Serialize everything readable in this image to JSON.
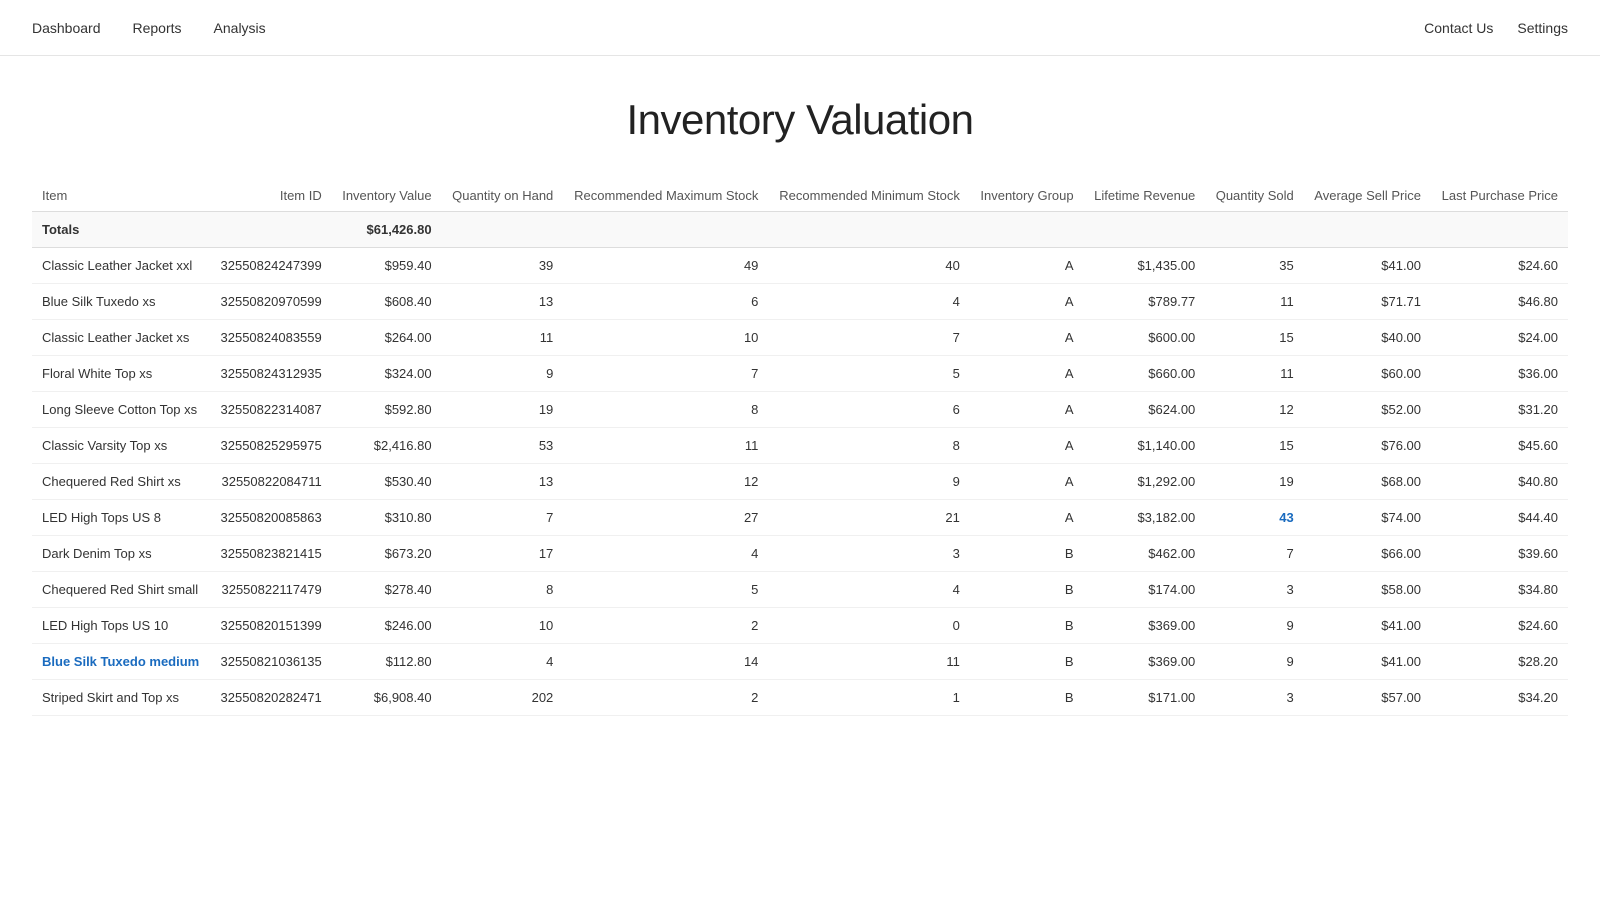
{
  "nav": {
    "items": [
      "Dashboard",
      "Reports",
      "Analysis"
    ],
    "right_items": [
      "Contact Us",
      "Settings"
    ]
  },
  "page_title": "Inventory Valuation",
  "table": {
    "columns": [
      "Item",
      "Item ID",
      "Inventory Value",
      "Quantity on Hand",
      "Recommended Maximum Stock",
      "Recommended Minimum Stock",
      "Inventory Group",
      "Lifetime Revenue",
      "Quantity Sold",
      "Average Sell Price",
      "Last Purchase Price"
    ],
    "totals": {
      "label": "Totals",
      "inventory_value": "$61,426.80"
    },
    "rows": [
      {
        "item": "Classic Leather Jacket xxl",
        "item_id": "32550824247399",
        "inventory_value": "$959.40",
        "qty_on_hand": "39",
        "rec_max_stock": "49",
        "rec_min_stock": "40",
        "inventory_group": "A",
        "lifetime_revenue": "$1,435.00",
        "qty_sold": "35",
        "avg_sell_price": "$41.00",
        "last_purchase_price": "$24.60",
        "highlight_qty_sold": false
      },
      {
        "item": "Blue Silk Tuxedo xs",
        "item_id": "32550820970599",
        "inventory_value": "$608.40",
        "qty_on_hand": "13",
        "rec_max_stock": "6",
        "rec_min_stock": "4",
        "inventory_group": "A",
        "lifetime_revenue": "$789.77",
        "qty_sold": "11",
        "avg_sell_price": "$71.71",
        "last_purchase_price": "$46.80",
        "highlight_qty_sold": false
      },
      {
        "item": "Classic Leather Jacket xs",
        "item_id": "32550824083559",
        "inventory_value": "$264.00",
        "qty_on_hand": "11",
        "rec_max_stock": "10",
        "rec_min_stock": "7",
        "inventory_group": "A",
        "lifetime_revenue": "$600.00",
        "qty_sold": "15",
        "avg_sell_price": "$40.00",
        "last_purchase_price": "$24.00",
        "highlight_qty_sold": false
      },
      {
        "item": "Floral White Top xs",
        "item_id": "32550824312935",
        "inventory_value": "$324.00",
        "qty_on_hand": "9",
        "rec_max_stock": "7",
        "rec_min_stock": "5",
        "inventory_group": "A",
        "lifetime_revenue": "$660.00",
        "qty_sold": "11",
        "avg_sell_price": "$60.00",
        "last_purchase_price": "$36.00",
        "highlight_qty_sold": false
      },
      {
        "item": "Long Sleeve Cotton Top xs",
        "item_id": "32550822314087",
        "inventory_value": "$592.80",
        "qty_on_hand": "19",
        "rec_max_stock": "8",
        "rec_min_stock": "6",
        "inventory_group": "A",
        "lifetime_revenue": "$624.00",
        "qty_sold": "12",
        "avg_sell_price": "$52.00",
        "last_purchase_price": "$31.20",
        "highlight_qty_sold": false
      },
      {
        "item": "Classic Varsity Top xs",
        "item_id": "32550825295975",
        "inventory_value": "$2,416.80",
        "qty_on_hand": "53",
        "rec_max_stock": "11",
        "rec_min_stock": "8",
        "inventory_group": "A",
        "lifetime_revenue": "$1,140.00",
        "qty_sold": "15",
        "avg_sell_price": "$76.00",
        "last_purchase_price": "$45.60",
        "highlight_qty_sold": false
      },
      {
        "item": "Chequered Red Shirt xs",
        "item_id": "32550822084711",
        "inventory_value": "$530.40",
        "qty_on_hand": "13",
        "rec_max_stock": "12",
        "rec_min_stock": "9",
        "inventory_group": "A",
        "lifetime_revenue": "$1,292.00",
        "qty_sold": "19",
        "avg_sell_price": "$68.00",
        "last_purchase_price": "$40.80",
        "highlight_qty_sold": false
      },
      {
        "item": "LED High Tops US 8",
        "item_id": "32550820085863",
        "inventory_value": "$310.80",
        "qty_on_hand": "7",
        "rec_max_stock": "27",
        "rec_min_stock": "21",
        "inventory_group": "A",
        "lifetime_revenue": "$3,182.00",
        "qty_sold": "43",
        "avg_sell_price": "$74.00",
        "last_purchase_price": "$44.40",
        "highlight_qty_sold": true
      },
      {
        "item": "Dark Denim Top xs",
        "item_id": "32550823821415",
        "inventory_value": "$673.20",
        "qty_on_hand": "17",
        "rec_max_stock": "4",
        "rec_min_stock": "3",
        "inventory_group": "B",
        "lifetime_revenue": "$462.00",
        "qty_sold": "7",
        "avg_sell_price": "$66.00",
        "last_purchase_price": "$39.60",
        "highlight_qty_sold": false
      },
      {
        "item": "Chequered Red Shirt small",
        "item_id": "32550822117479",
        "inventory_value": "$278.40",
        "qty_on_hand": "8",
        "rec_max_stock": "5",
        "rec_min_stock": "4",
        "inventory_group": "B",
        "lifetime_revenue": "$174.00",
        "qty_sold": "3",
        "avg_sell_price": "$58.00",
        "last_purchase_price": "$34.80",
        "highlight_qty_sold": false
      },
      {
        "item": "LED High Tops US 10",
        "item_id": "32550820151399",
        "inventory_value": "$246.00",
        "qty_on_hand": "10",
        "rec_max_stock": "2",
        "rec_min_stock": "0",
        "inventory_group": "B",
        "lifetime_revenue": "$369.00",
        "qty_sold": "9",
        "avg_sell_price": "$41.00",
        "last_purchase_price": "$24.60",
        "highlight_qty_sold": false
      },
      {
        "item": "Blue Silk Tuxedo medium",
        "item_id": "32550821036135",
        "inventory_value": "$112.80",
        "qty_on_hand": "4",
        "rec_max_stock": "14",
        "rec_min_stock": "11",
        "inventory_group": "B",
        "lifetime_revenue": "$369.00",
        "qty_sold": "9",
        "avg_sell_price": "$41.00",
        "last_purchase_price": "$28.20",
        "highlight_qty_sold": false,
        "highlight_item": true
      },
      {
        "item": "Striped Skirt and Top xs",
        "item_id": "32550820282471",
        "inventory_value": "$6,908.40",
        "qty_on_hand": "202",
        "rec_max_stock": "2",
        "rec_min_stock": "1",
        "inventory_group": "B",
        "lifetime_revenue": "$171.00",
        "qty_sold": "3",
        "avg_sell_price": "$57.00",
        "last_purchase_price": "$34.20",
        "highlight_qty_sold": false
      }
    ]
  }
}
